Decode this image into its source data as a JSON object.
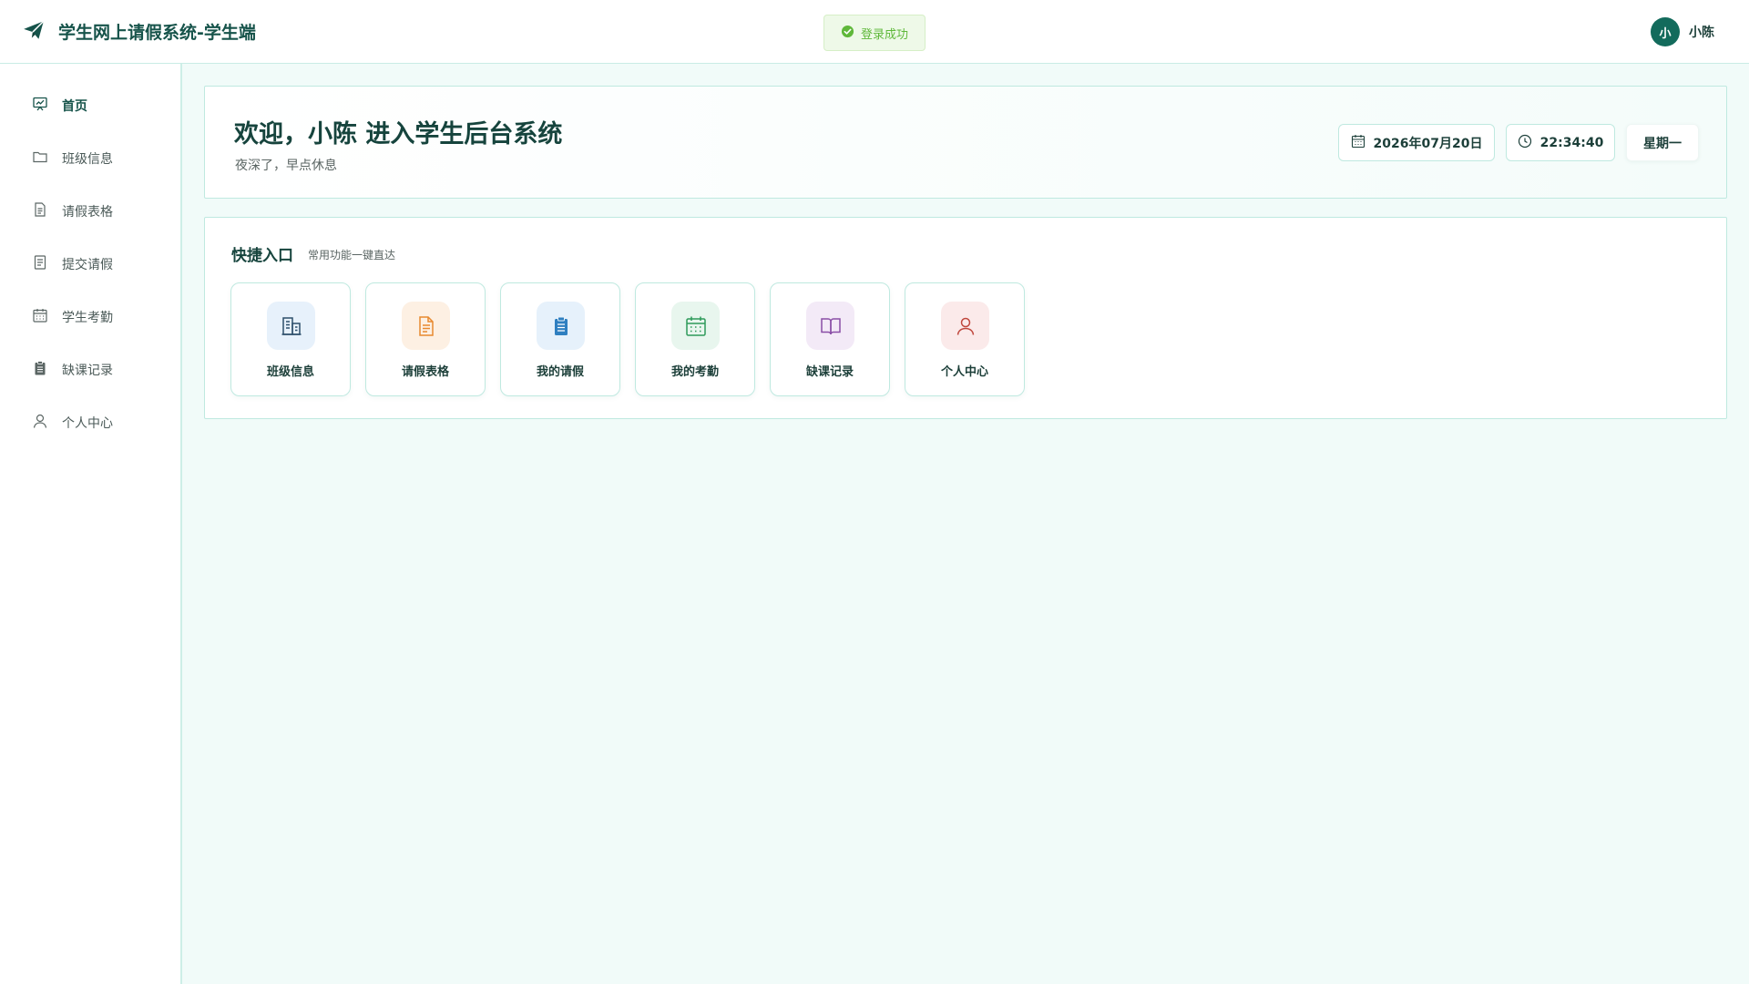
{
  "header": {
    "app_title": "学生网上请假系统-学生端",
    "logo_icon": "paper-plane-icon",
    "toast": {
      "text": "登录成功",
      "icon": "check-circle-icon",
      "color": "#5fb83a"
    },
    "user": {
      "avatar_text": "小",
      "name": "小陈"
    }
  },
  "sidebar": {
    "items": [
      {
        "label": "首页",
        "icon": "dashboard-icon",
        "active": true
      },
      {
        "label": "班级信息",
        "icon": "folder-icon",
        "active": false
      },
      {
        "label": "请假表格",
        "icon": "document-icon",
        "active": false
      },
      {
        "label": "提交请假",
        "icon": "form-icon",
        "active": false
      },
      {
        "label": "学生考勤",
        "icon": "calendar-icon",
        "active": false
      },
      {
        "label": "缺课记录",
        "icon": "clipboard-icon",
        "active": false
      },
      {
        "label": "个人中心",
        "icon": "user-icon",
        "active": false
      }
    ]
  },
  "welcome": {
    "title": "欢迎，小陈 进入学生后台系统",
    "subtitle": "夜深了，早点休息",
    "date": "2026年07月20日",
    "time": "22:34:40",
    "weekday": "星期一"
  },
  "quick": {
    "title": "快捷入口",
    "subtitle": "常用功能一键直达",
    "cards": [
      {
        "label": "班级信息",
        "icon": "building-icon",
        "color": "#2d4f6b",
        "bg": "#e7f1fb"
      },
      {
        "label": "请假表格",
        "icon": "document-icon",
        "color": "#e8892f",
        "bg": "#fdf0e3"
      },
      {
        "label": "我的请假",
        "icon": "clipboard-icon",
        "color": "#2f7fc0",
        "bg": "#e6f1fb"
      },
      {
        "label": "我的考勤",
        "icon": "calendar-icon",
        "color": "#2e9a5a",
        "bg": "#e8f6ee"
      },
      {
        "label": "缺课记录",
        "icon": "book-icon",
        "color": "#8a4ea6",
        "bg": "#f3eaf7"
      },
      {
        "label": "个人中心",
        "icon": "user-icon",
        "color": "#c0473d",
        "bg": "#fbeaea"
      }
    ]
  },
  "colors": {
    "brand": "#16534a",
    "accent_border": "#bfe9e0",
    "page_bg": "#f1fbf9"
  }
}
